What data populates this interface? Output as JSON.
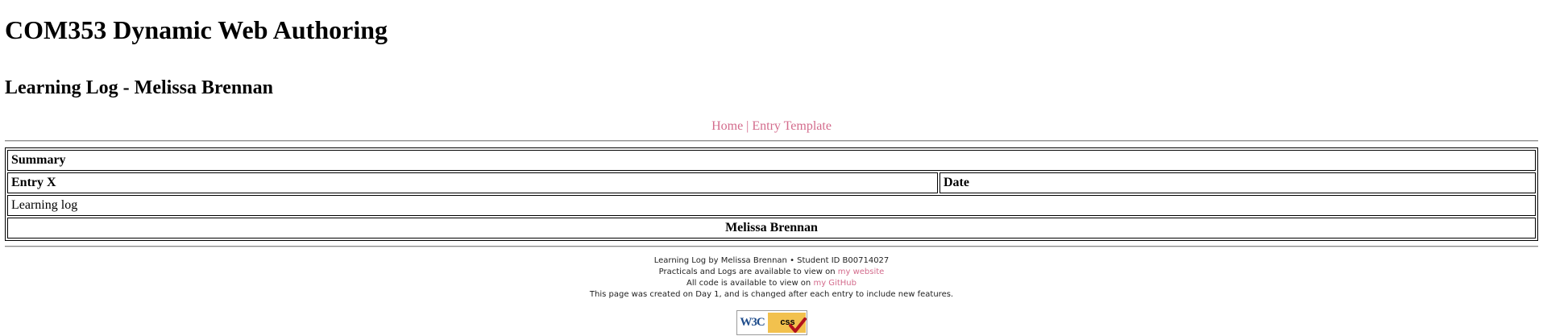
{
  "header": {
    "title": "COM353 Dynamic Web Authoring",
    "subtitle": "Learning Log - Melissa Brennan"
  },
  "nav": {
    "links": [
      {
        "label": "Home"
      },
      {
        "label": "Entry Template"
      }
    ],
    "separator": "|"
  },
  "table": {
    "summary_heading": "Summary",
    "entry_heading": "Entry X",
    "date_heading": "Date",
    "body_text": "Learning log",
    "author": "Melissa Brennan"
  },
  "footer": {
    "line1": "Learning Log by Melissa Brennan • Student ID B00714027",
    "line2_prefix": "Practicals and Logs are available to view on",
    "line2_link": "my website",
    "line3_prefix": "All code is available to view on",
    "line3_link": "my GitHub",
    "line4": "This page was created on Day 1, and is changed after each entry to include new features."
  },
  "badge": {
    "left_text": "W3C",
    "right_text": "css",
    "icon": "w3c-css-valid-badge"
  },
  "colors": {
    "link": "#d36b8c",
    "badge_yellow": "#f2c14e",
    "badge_blue": "#1f4d8c",
    "check_red": "#b3121c"
  }
}
